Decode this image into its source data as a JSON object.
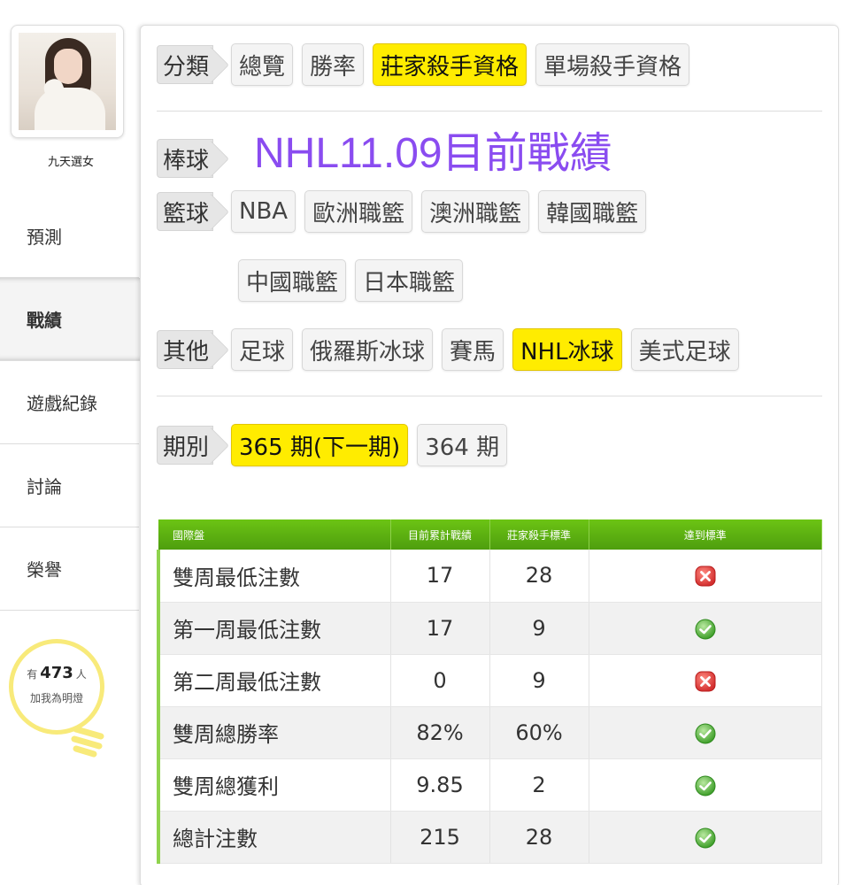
{
  "sidebar": {
    "username": "九天選女",
    "nav": [
      {
        "label": "預測",
        "active": false
      },
      {
        "label": "戰績",
        "active": true
      },
      {
        "label": "遊戲紀錄",
        "active": false
      },
      {
        "label": "討論",
        "active": false
      },
      {
        "label": "榮譽",
        "active": false
      }
    ],
    "fans": {
      "prefix": "有",
      "count": "473",
      "suffix": "人",
      "line2": "加我為明燈"
    }
  },
  "filters": {
    "category": {
      "label": "分類",
      "options": [
        "總覽",
        "勝率",
        "莊家殺手資格",
        "單場殺手資格"
      ],
      "selected": "莊家殺手資格"
    },
    "baseball_label": "棒球",
    "headline": "NHL11.09目前戰績",
    "basketball": {
      "label": "籃球",
      "options": [
        "NBA",
        "歐洲職籃",
        "澳洲職籃",
        "韓國職籃",
        "中國職籃",
        "日本職籃"
      ]
    },
    "other": {
      "label": "其他",
      "options": [
        "足球",
        "俄羅斯冰球",
        "賽馬",
        "NHL冰球",
        "美式足球"
      ],
      "selected": "NHL冰球"
    },
    "period": {
      "label": "期別",
      "options": [
        "365 期(下一期)",
        "364 期"
      ],
      "selected": "365 期(下一期)"
    }
  },
  "table": {
    "headers": [
      "國際盤",
      "目前累計戰績",
      "莊家殺手標準",
      "達到標準"
    ],
    "rows": [
      {
        "name": "雙周最低注數",
        "current": "17",
        "standard": "28",
        "met": false
      },
      {
        "name": "第一周最低注數",
        "current": "17",
        "standard": "9",
        "met": true
      },
      {
        "name": "第二周最低注數",
        "current": "0",
        "standard": "9",
        "met": false
      },
      {
        "name": "雙周總勝率",
        "current": "82%",
        "standard": "60%",
        "met": true
      },
      {
        "name": "雙周總獲利",
        "current": "9.85",
        "standard": "2",
        "met": true
      },
      {
        "name": "總計注數",
        "current": "215",
        "standard": "28",
        "met": true
      }
    ]
  },
  "colors": {
    "accent": "#8a4cf0",
    "selected": "#ffec00",
    "header_green": "#5aab12",
    "fail": "#e53935",
    "pass": "#4caf50"
  }
}
